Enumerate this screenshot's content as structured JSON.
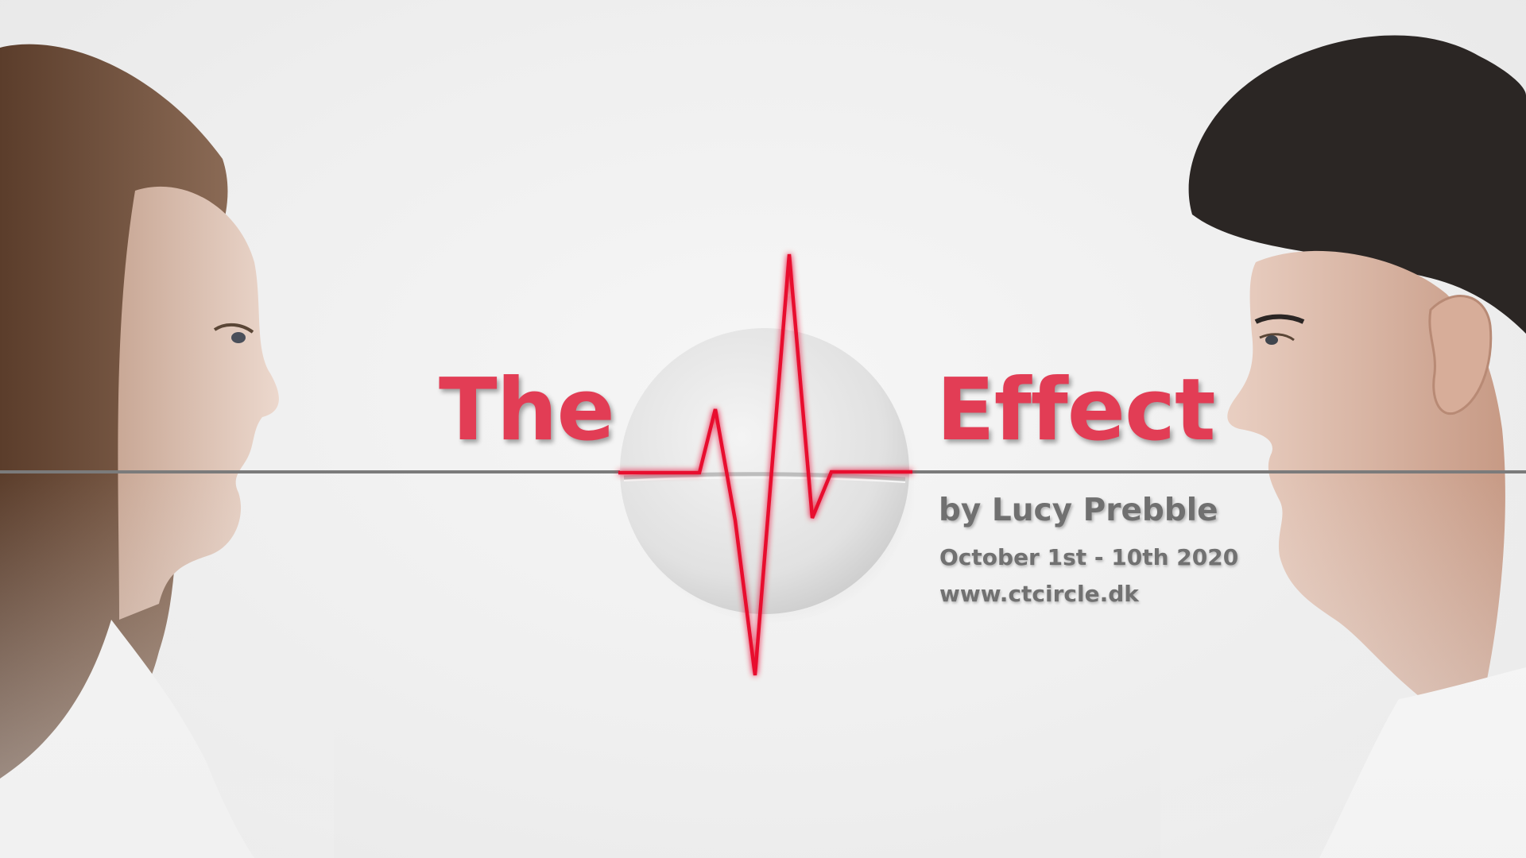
{
  "poster": {
    "title_left": "The",
    "title_right": "Effect",
    "author": "by Lucy Prebble",
    "dates": "October 1st - 10th 2020",
    "website": "www.ctcircle.dk"
  },
  "colors": {
    "accent_red": "#e23d55",
    "heartbeat_red": "#e8102e",
    "text_grey": "#707070",
    "line_grey": "#7b7b7b",
    "background": "#efefef"
  },
  "images": {
    "left_portrait": "woman-profile-facing-right",
    "right_portrait": "man-profile-facing-left",
    "center_object": "white-round-pill-tablet",
    "center_graphic": "heartbeat-ecg-line"
  }
}
